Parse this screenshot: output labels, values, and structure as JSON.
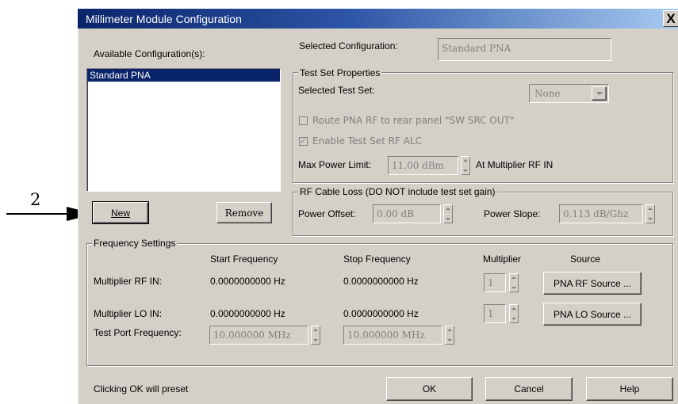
{
  "window": {
    "title": "Millimeter Module Configuration",
    "close_label": "X"
  },
  "callout": {
    "number": "2"
  },
  "available": {
    "label": "Available Configuration(s):",
    "items": [
      "Standard PNA"
    ],
    "new_label": "New",
    "remove_label": "Remove"
  },
  "selected": {
    "label": "Selected Configuration:",
    "value": "Standard PNA"
  },
  "testset": {
    "legend": "Test Set Properties",
    "selected_label": "Selected Test Set:",
    "selected_value": "None",
    "route_label": "Route PNA RF to rear panel \"SW SRC OUT\"",
    "route_checked": false,
    "alc_label": "Enable Test Set RF ALC",
    "alc_checked": true,
    "maxpower_label": "Max Power Limit:",
    "maxpower_value": "11.00 dBm",
    "maxpower_suffix": "At Multiplier RF IN"
  },
  "cable": {
    "legend": "RF Cable Loss (DO NOT include test set gain)",
    "offset_label": "Power Offset:",
    "offset_value": "0.00 dB",
    "slope_label": "Power Slope:",
    "slope_value": "0.113 dB/Ghz"
  },
  "freq": {
    "legend": "Frequency Settings",
    "headers": {
      "start": "Start Frequency",
      "stop": "Stop Frequency",
      "mult": "Multiplier",
      "source": "Source"
    },
    "rows": [
      {
        "label": "Multiplier RF IN:",
        "start": "0.0000000000 Hz",
        "stop": "0.0000000000 Hz",
        "mult": "1",
        "source": "PNA RF Source ..."
      },
      {
        "label": "Multiplier LO IN:",
        "start": "0.0000000000 Hz",
        "stop": "0.0000000000 Hz",
        "mult": "1",
        "source": "PNA LO Source ..."
      }
    ],
    "testport": {
      "label": "Test Port Frequency:",
      "start": "10.000000 MHz",
      "stop": "10.000000 MHz"
    }
  },
  "footer": {
    "note": "Clicking OK will preset",
    "ok": "OK",
    "cancel": "Cancel",
    "help": "Help"
  }
}
